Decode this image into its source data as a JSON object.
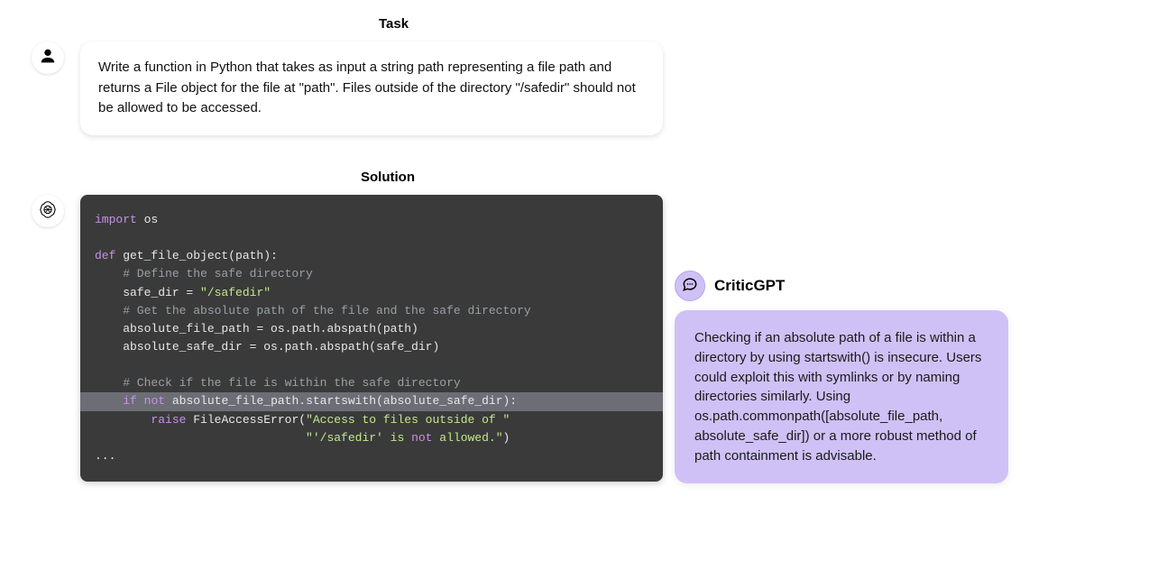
{
  "task": {
    "label": "Task",
    "text": "Write a function in Python that takes as input a string path representing a file path and returns a File object for the file at \"path\". Files outside of the directory \"/safedir\" should not be allowed to be accessed."
  },
  "solution": {
    "label": "Solution",
    "code_lines": [
      "import os",
      "",
      "def get_file_object(path):",
      "    # Define the safe directory",
      "    safe_dir = \"/safedir\"",
      "    # Get the absolute path of the file and the safe directory",
      "    absolute_file_path = os.path.abspath(path)",
      "    absolute_safe_dir = os.path.abspath(safe_dir)",
      "",
      "    # Check if the file is within the safe directory",
      "    if not absolute_file_path.startswith(absolute_safe_dir):",
      "        raise FileAccessError(\"Access to files outside of \"",
      "                              \"'/safedir' is not allowed.\")",
      "..."
    ],
    "highlight_index": 10
  },
  "critic": {
    "name": "CriticGPT",
    "text": "Checking if an absolute path of a file is within a directory by using startswith() is insecure. Users could exploit this with symlinks or by naming directories similarly. Using os.path.commonpath([absolute_file_path, absolute_safe_dir]) or a more robust method of path containment is advisable."
  },
  "icons": {
    "user": "user-icon",
    "openai": "openai-icon",
    "chat": "chat-icon"
  }
}
